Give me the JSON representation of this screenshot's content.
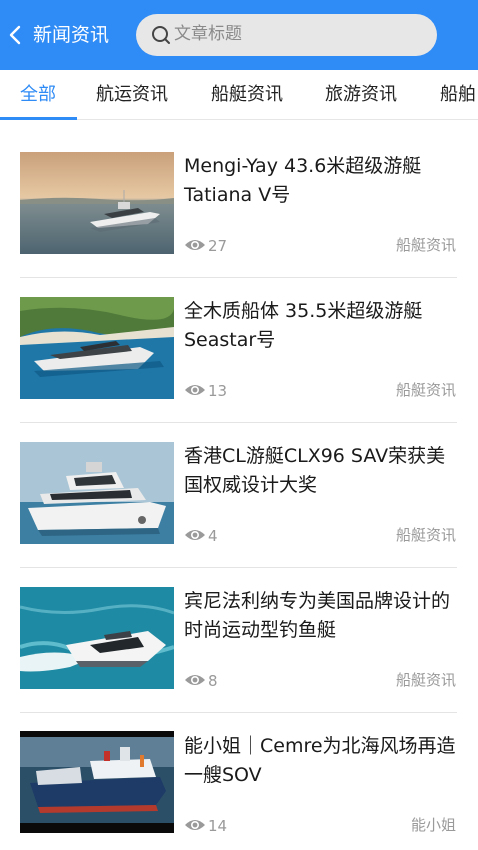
{
  "header": {
    "title": "新闻资讯",
    "search_placeholder": "文章标题",
    "accent_color": "#2f8bf5"
  },
  "tabs": [
    {
      "label": "全部",
      "active": true
    },
    {
      "label": "航运资讯",
      "active": false
    },
    {
      "label": "船艇资讯",
      "active": false
    },
    {
      "label": "旅游资讯",
      "active": false
    },
    {
      "label": "船舶",
      "active": false
    }
  ],
  "articles": [
    {
      "title": "Mengi-Yay 43.6米超级游艇Tatiana V号",
      "views": "27",
      "category": "船艇资讯"
    },
    {
      "title": "全木质船体 35.5米超级游艇Seastar号",
      "views": "13",
      "category": "船艇资讯"
    },
    {
      "title": "香港CL游艇CLX96 SAV荣获美国权威设计大奖",
      "views": "4",
      "category": "船艇资讯"
    },
    {
      "title": "宾尼法利纳专为美国品牌设计的时尚运动型钓鱼艇",
      "views": "8",
      "category": "船艇资讯"
    },
    {
      "title": "能小姐｜Cemre为北海风场再造一艘SOV",
      "views": "14",
      "category": "能小姐"
    }
  ]
}
